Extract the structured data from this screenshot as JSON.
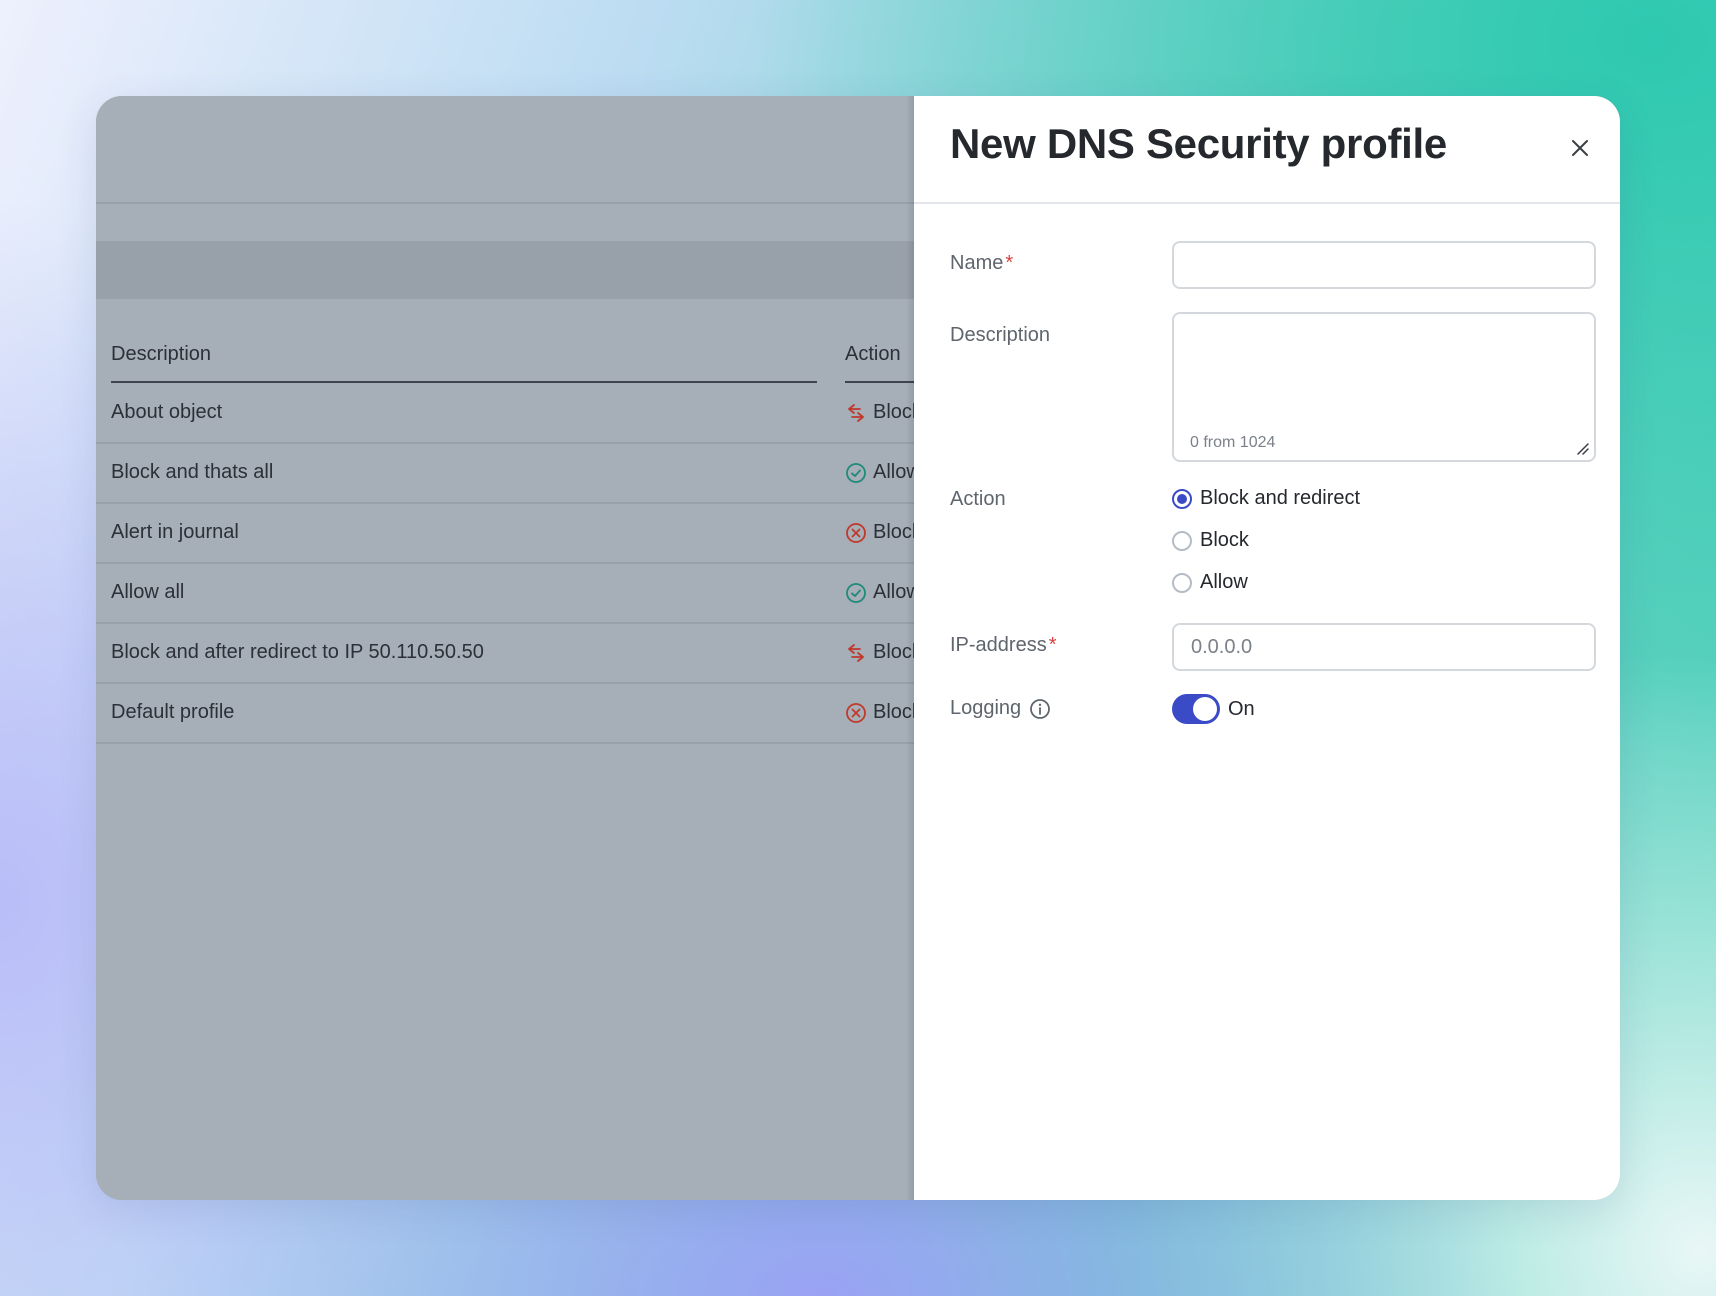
{
  "table": {
    "col_description": "Description",
    "col_action": "Action",
    "rows": [
      {
        "description": "About object",
        "action": "Block",
        "action_icon": "redirect-icon"
      },
      {
        "description": "Block and thats all",
        "action": "Allow",
        "action_icon": "check-circle-icon"
      },
      {
        "description": "Alert in journal",
        "action": "Block",
        "action_icon": "x-circle-icon"
      },
      {
        "description": "Allow all",
        "action": "Allow",
        "action_icon": "check-circle-icon"
      },
      {
        "description": "Block and after redirect to IP 50.110.50.50",
        "action": "Block",
        "action_icon": "redirect-icon"
      },
      {
        "description": "Default profile",
        "action": "Block",
        "action_icon": "x-circle-icon"
      }
    ]
  },
  "panel": {
    "title": "New DNS Security profile",
    "name_label": "Name",
    "required_mark": "*",
    "name_value": "",
    "description_label": "Description",
    "description_counter": "0 from 1024",
    "action_label": "Action",
    "action_options": [
      "Block and redirect",
      "Block",
      "Allow"
    ],
    "action_selected": "Block and redirect",
    "ip_label": "IP-address",
    "ip_placeholder": "0.0.0.0",
    "logging_label": "Logging",
    "logging_state": "On"
  },
  "colors": {
    "accent": "#3b4bc8",
    "required": "#d9413f",
    "allow_icon": "#1f8a7a",
    "block_icon": "#c0392b"
  }
}
